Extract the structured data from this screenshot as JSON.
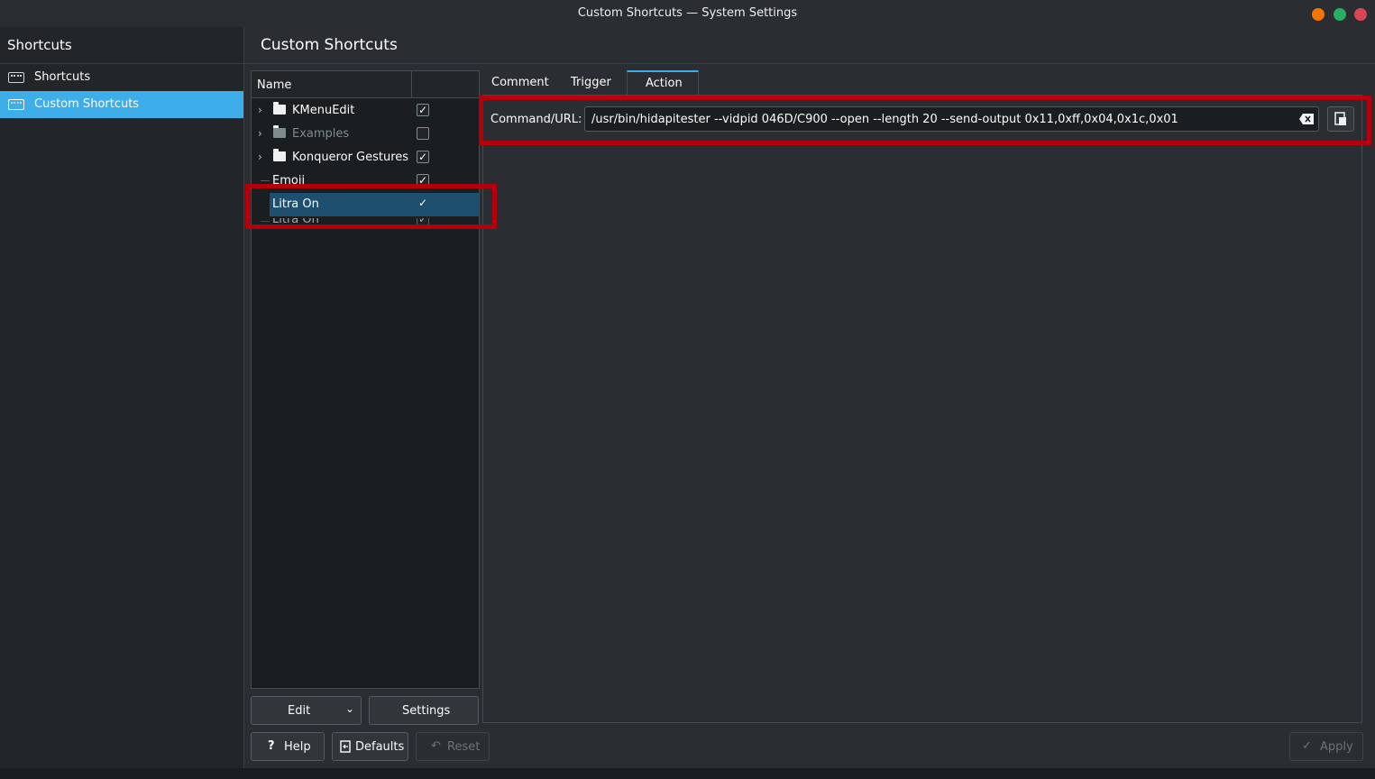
{
  "window": {
    "title": "Custom Shortcuts — System Settings",
    "controls": {
      "minimize_color": "#f67400",
      "maximize_color": "#27ae60",
      "close_color": "#da4453"
    }
  },
  "sidebar": {
    "header": "Shortcuts",
    "items": [
      {
        "label": "Shortcuts",
        "icon": "keyboard-icon",
        "selected": false
      },
      {
        "label": "Custom Shortcuts",
        "icon": "keyboard-icon",
        "selected": true
      }
    ]
  },
  "main": {
    "title": "Custom Shortcuts",
    "tree": {
      "column_name": "Name",
      "rows": [
        {
          "name": "KMenuEdit",
          "type": "folder",
          "checked": true
        },
        {
          "name": "Examples",
          "type": "folder",
          "checked": false
        },
        {
          "name": "Konqueror Gestures",
          "type": "folder",
          "checked": true
        },
        {
          "name": "Emoji",
          "type": "item",
          "checked": true
        },
        {
          "name": "Litra On",
          "type": "item",
          "checked": true,
          "selected": true
        },
        {
          "name": "Litra On",
          "type": "item",
          "checked": true
        }
      ]
    },
    "tabs": [
      "Comment",
      "Trigger",
      "Action"
    ],
    "active_tab": "Action",
    "action": {
      "command_label": "Command/URL:",
      "command_value": "/usr/bin/hidapitester --vidpid 046D/C900 --open --length 20 --send-output 0x11,0xff,0x04,0x1c,0x01"
    },
    "tree_buttons": {
      "edit": "Edit",
      "settings": "Settings"
    },
    "footer": {
      "help": "Help",
      "defaults": "Defaults",
      "reset": "Reset",
      "apply": "Apply"
    }
  },
  "colors": {
    "accent": "#3daee9",
    "highlight_box": "#b3000b",
    "selected_row": "#1e4f6e"
  }
}
